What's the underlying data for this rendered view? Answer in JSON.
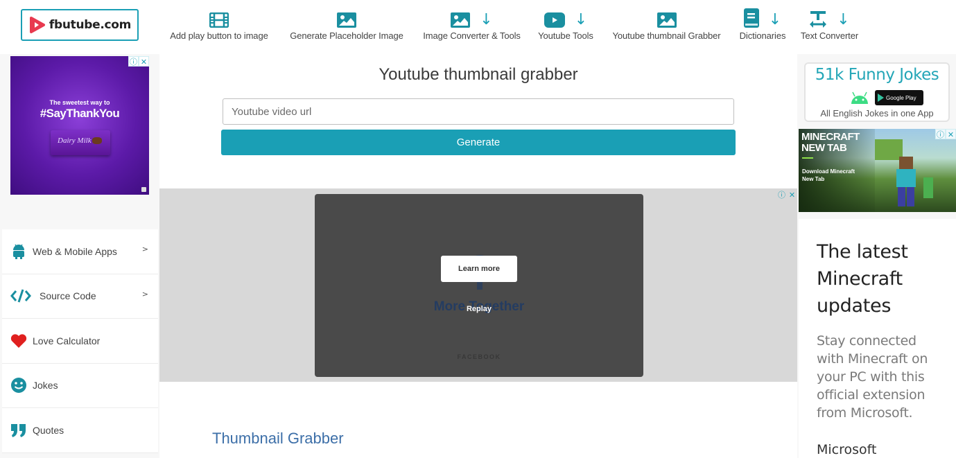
{
  "header": {
    "logo_text": "fbutube.com",
    "nav": [
      {
        "label": "Add play button to image",
        "icon": "film-icon",
        "has_dropdown": false
      },
      {
        "label": "Generate Placeholder Image",
        "icon": "image-icon",
        "has_dropdown": false
      },
      {
        "label": "Image Converter & Tools",
        "icon": "image-icon",
        "has_dropdown": true
      },
      {
        "label": "Youtube Tools",
        "icon": "youtube-icon",
        "has_dropdown": true
      },
      {
        "label": "Youtube thumbnail Grabber",
        "icon": "image-icon",
        "has_dropdown": false
      },
      {
        "label": "Dictionaries",
        "icon": "book-icon",
        "has_dropdown": true
      },
      {
        "label": "Text Converter",
        "icon": "text-width-icon",
        "has_dropdown": true
      }
    ],
    "dropdown_glyph": "↓"
  },
  "left_ad": {
    "line1": "The sweetest way to",
    "line2": "#SayThankYou",
    "product": "Dairy Milk",
    "info_glyph": "ⓘ",
    "close_glyph": "✕"
  },
  "sidebar": {
    "items": [
      {
        "label": "Web & Mobile Apps",
        "icon": "android-icon",
        "chevron": ">"
      },
      {
        "label": "Source Code",
        "icon": "code-icon",
        "chevron": ">"
      },
      {
        "label": "Love Calculator",
        "icon": "heart-icon",
        "chevron": ""
      },
      {
        "label": "Jokes",
        "icon": "smile-icon",
        "chevron": ""
      },
      {
        "label": "Quotes",
        "icon": "quote-icon",
        "chevron": ""
      }
    ]
  },
  "main": {
    "title": "Youtube thumbnail grabber",
    "url_input": {
      "value": "",
      "placeholder": "Youtube video url"
    },
    "generate_label": "Generate",
    "video_ad": {
      "learn_more": "Learn more",
      "headline": "More Together",
      "replay": "Replay",
      "footer": "FACEBOOK"
    },
    "section_title": "Thumbnail Grabber"
  },
  "right": {
    "jokes_ad": {
      "title": "51k Funny Jokes",
      "store_label": "Google Play",
      "subtitle": "All English Jokes in one App"
    },
    "minecraft_ad": {
      "title_line1": "MINECRAFT",
      "title_line2": "NEW TAB",
      "sub_line1": "Download Minecraft",
      "sub_line2": "New Tab"
    },
    "microsoft_ad": {
      "headline_lines": [
        "The latest",
        "Minecraft",
        "updates"
      ],
      "body_lines": [
        "Stay connected",
        "with Minecraft on",
        "your PC with this",
        "official extension",
        "from Microsoft."
      ],
      "brand": "Microsoft"
    }
  },
  "colors": {
    "accent": "#1a9fb5",
    "section_title": "#3d6fa8",
    "heart": "#e0201f"
  }
}
